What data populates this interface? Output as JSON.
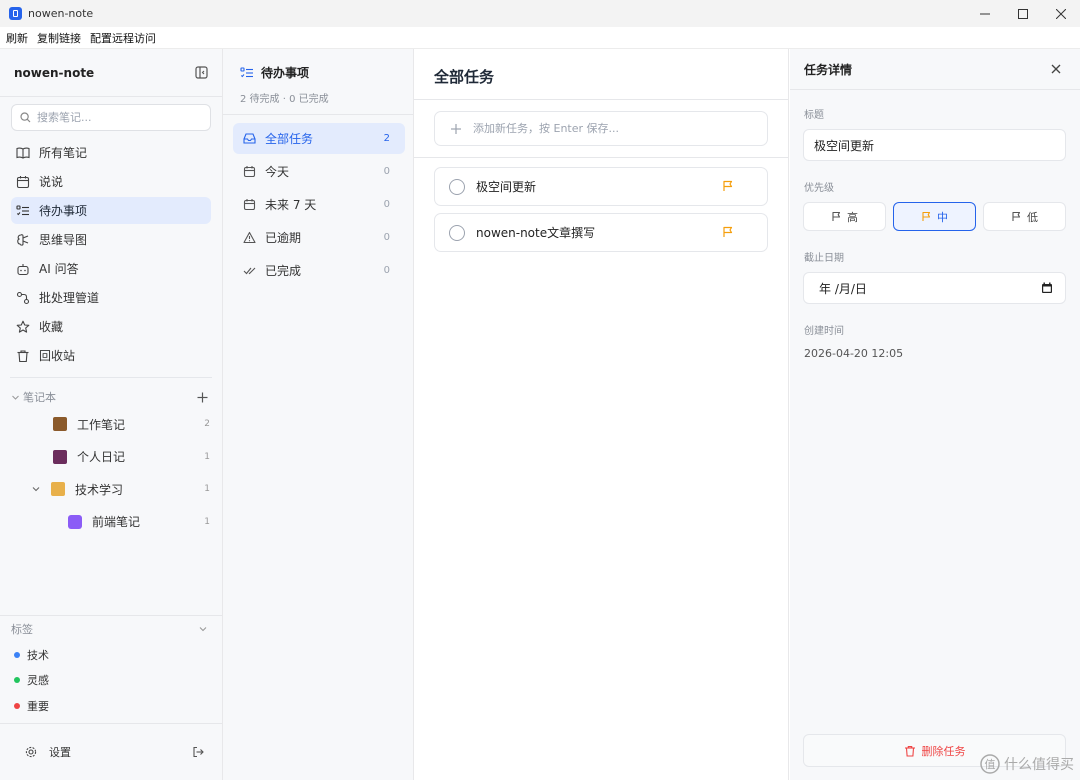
{
  "window": {
    "title": "nowen-note"
  },
  "menu": [
    "刷新",
    "复制链接",
    "配置远程访问"
  ],
  "sidebar": {
    "brand": "nowen-note",
    "search_placeholder": "搜索笔记...",
    "nav": [
      {
        "label": "所有笔记",
        "icon": "book-icon"
      },
      {
        "label": "说说",
        "icon": "calendar-icon"
      },
      {
        "label": "待办事项",
        "icon": "list-todo-icon",
        "active": true
      },
      {
        "label": "思维导图",
        "icon": "mindmap-icon"
      },
      {
        "label": "AI 问答",
        "icon": "bot-icon"
      },
      {
        "label": "批处理管道",
        "icon": "pipeline-icon"
      },
      {
        "label": "收藏",
        "icon": "star-icon"
      },
      {
        "label": "回收站",
        "icon": "trash-icon"
      }
    ],
    "notebooks_label": "笔记本",
    "notebooks": [
      {
        "label": "工作笔记",
        "count": "2",
        "icon": "briefcase-emoji"
      },
      {
        "label": "个人日记",
        "count": "1",
        "icon": "book-emoji"
      },
      {
        "label": "技术学习",
        "count": "1",
        "icon": "technologist-emoji"
      },
      {
        "label": "前端笔记",
        "count": "1",
        "icon": "atom-emoji"
      }
    ],
    "tags_label": "标签",
    "tags": [
      {
        "label": "技术",
        "color": "#3b82f6"
      },
      {
        "label": "灵感",
        "color": "#22c55e"
      },
      {
        "label": "重要",
        "color": "#ef4444"
      }
    ],
    "settings_label": "设置"
  },
  "todo": {
    "title": "待办事项",
    "subtitle": "2 待完成 · 0 已完成",
    "filters": [
      {
        "label": "全部任务",
        "count": "2",
        "icon": "inbox-icon"
      },
      {
        "label": "今天",
        "count": "0",
        "icon": "calendar-icon"
      },
      {
        "label": "未来 7 天",
        "count": "0",
        "icon": "calendar-range-icon"
      },
      {
        "label": "已逾期",
        "count": "0",
        "icon": "alert-icon"
      },
      {
        "label": "已完成",
        "count": "0",
        "icon": "check-check-icon"
      }
    ]
  },
  "main": {
    "title": "全部任务",
    "add_placeholder": "添加新任务，按 Enter 保存...",
    "tasks": [
      {
        "title": "极空间更新",
        "priority_color": "#f59e0b"
      },
      {
        "title": "nowen-note文章撰写",
        "priority_color": "#f59e0b"
      }
    ]
  },
  "detail": {
    "header": "任务详情",
    "title_label": "标题",
    "title_value": "极空间更新",
    "priority_label": "优先级",
    "priorities": [
      {
        "label": "高",
        "active": false
      },
      {
        "label": "中",
        "active": true
      },
      {
        "label": "低",
        "active": false
      }
    ],
    "due_label": "截止日期",
    "due_placeholder": "年 /月/日",
    "created_label": "创建时间",
    "created_value": "2026-04-20 12:05",
    "delete_label": "删除任务"
  },
  "watermark": "什么值得买",
  "colors": {
    "accent": "#2563eb",
    "flag": "#f59e0b",
    "danger": "#ef4444"
  }
}
